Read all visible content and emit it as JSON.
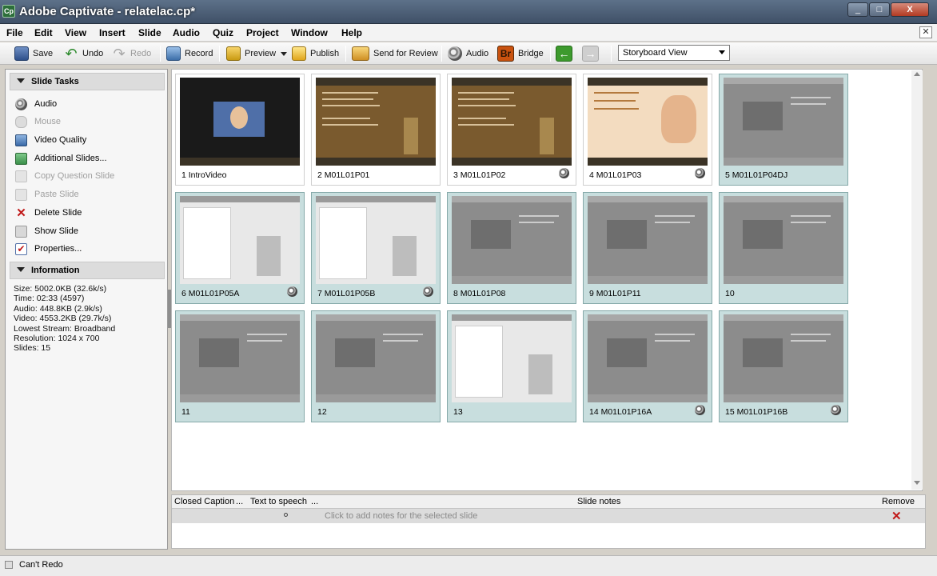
{
  "window": {
    "title": "Adobe Captivate - relatelac.cp*",
    "app_icon": "Cp",
    "controls": [
      "_",
      "□",
      "X"
    ]
  },
  "menubar": [
    "File",
    "Edit",
    "View",
    "Insert",
    "Slide",
    "Audio",
    "Quiz",
    "Project",
    "Window",
    "Help"
  ],
  "toolbar": {
    "save": "Save",
    "undo": "Undo",
    "redo": "Redo",
    "record": "Record",
    "preview": "Preview",
    "publish": "Publish",
    "send_for_review": "Send for Review",
    "audio": "Audio",
    "bridge_icon": "Br",
    "bridge": "Bridge",
    "view_select": "Storyboard View"
  },
  "slide_tasks": {
    "header": "Slide Tasks",
    "items": [
      {
        "label": "Audio",
        "enabled": true,
        "icon": "speaker-icon"
      },
      {
        "label": "Mouse",
        "enabled": false,
        "icon": "mouse-icon"
      },
      {
        "label": "Video Quality",
        "enabled": true,
        "icon": "video-quality-icon"
      },
      {
        "label": "Additional Slides...",
        "enabled": true,
        "icon": "additional-slides-icon"
      },
      {
        "label": "Copy Question Slide",
        "enabled": false,
        "icon": "copy-icon"
      },
      {
        "label": "Paste Slide",
        "enabled": false,
        "icon": "paste-icon"
      },
      {
        "label": "Delete Slide",
        "enabled": true,
        "icon": "delete-icon"
      },
      {
        "label": "Show Slide",
        "enabled": true,
        "icon": "show-slide-icon"
      },
      {
        "label": "Properties...",
        "enabled": true,
        "icon": "properties-icon"
      }
    ]
  },
  "information": {
    "header": "Information",
    "lines": [
      "Size: 5002.0KB (32.6k/s)",
      "Time: 02:33 (4597)",
      "Audio: 448.8KB (2.9k/s)",
      "Video: 4553.2KB (29.7k/s)",
      "Lowest Stream: Broadband",
      "Resolution: 1024 x 700",
      "Slides: 15"
    ]
  },
  "slides": [
    {
      "num": "1",
      "name": "IntroVideo",
      "audio": false,
      "selected": false,
      "style": "dark"
    },
    {
      "num": "2",
      "name": "M01L01P01",
      "audio": false,
      "selected": false,
      "style": "brown"
    },
    {
      "num": "3",
      "name": "M01L01P02",
      "audio": true,
      "selected": false,
      "style": "brown"
    },
    {
      "num": "4",
      "name": "M01L01P03",
      "audio": true,
      "selected": false,
      "style": "peach"
    },
    {
      "num": "5",
      "name": "M01L01P04DJ",
      "audio": false,
      "selected": true,
      "style": "gray"
    },
    {
      "num": "6",
      "name": "M01L01P05A",
      "audio": true,
      "selected": true,
      "style": "light"
    },
    {
      "num": "7",
      "name": "M01L01P05B",
      "audio": true,
      "selected": true,
      "style": "light"
    },
    {
      "num": "8",
      "name": "M01L01P08",
      "audio": false,
      "selected": true,
      "style": "gray"
    },
    {
      "num": "9",
      "name": "M01L01P11",
      "audio": false,
      "selected": true,
      "style": "gray"
    },
    {
      "num": "10",
      "name": "",
      "audio": false,
      "selected": true,
      "style": "gray"
    },
    {
      "num": "11",
      "name": "",
      "audio": false,
      "selected": true,
      "style": "gray"
    },
    {
      "num": "12",
      "name": "",
      "audio": false,
      "selected": true,
      "style": "gray"
    },
    {
      "num": "13",
      "name": "",
      "audio": false,
      "selected": true,
      "style": "light"
    },
    {
      "num": "14",
      "name": "M01L01P16A",
      "audio": true,
      "selected": true,
      "style": "gray"
    },
    {
      "num": "15",
      "name": "M01L01P16B",
      "audio": true,
      "selected": true,
      "style": "gray"
    }
  ],
  "bottom_panel": {
    "closed_caption": "Closed Caption",
    "cc_more": "...",
    "text_to_speech": "Text to speech",
    "tts_more": "...",
    "slide_notes": "Slide notes",
    "remove": "Remove",
    "notes_placeholder": "Click to add notes for the selected slide",
    "remove_icon": "✕"
  },
  "status": "Can't Redo"
}
